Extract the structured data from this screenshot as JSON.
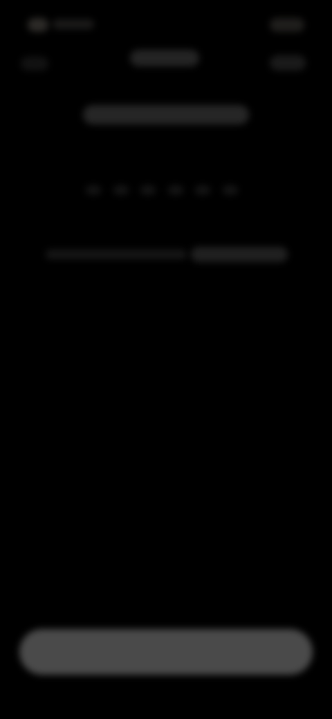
{
  "screen": {
    "background": "#000000",
    "text_legible": false
  },
  "colors": {
    "button": "#4a4a4a",
    "placeholder_dim": "#161616",
    "placeholder_light": "#262626"
  }
}
